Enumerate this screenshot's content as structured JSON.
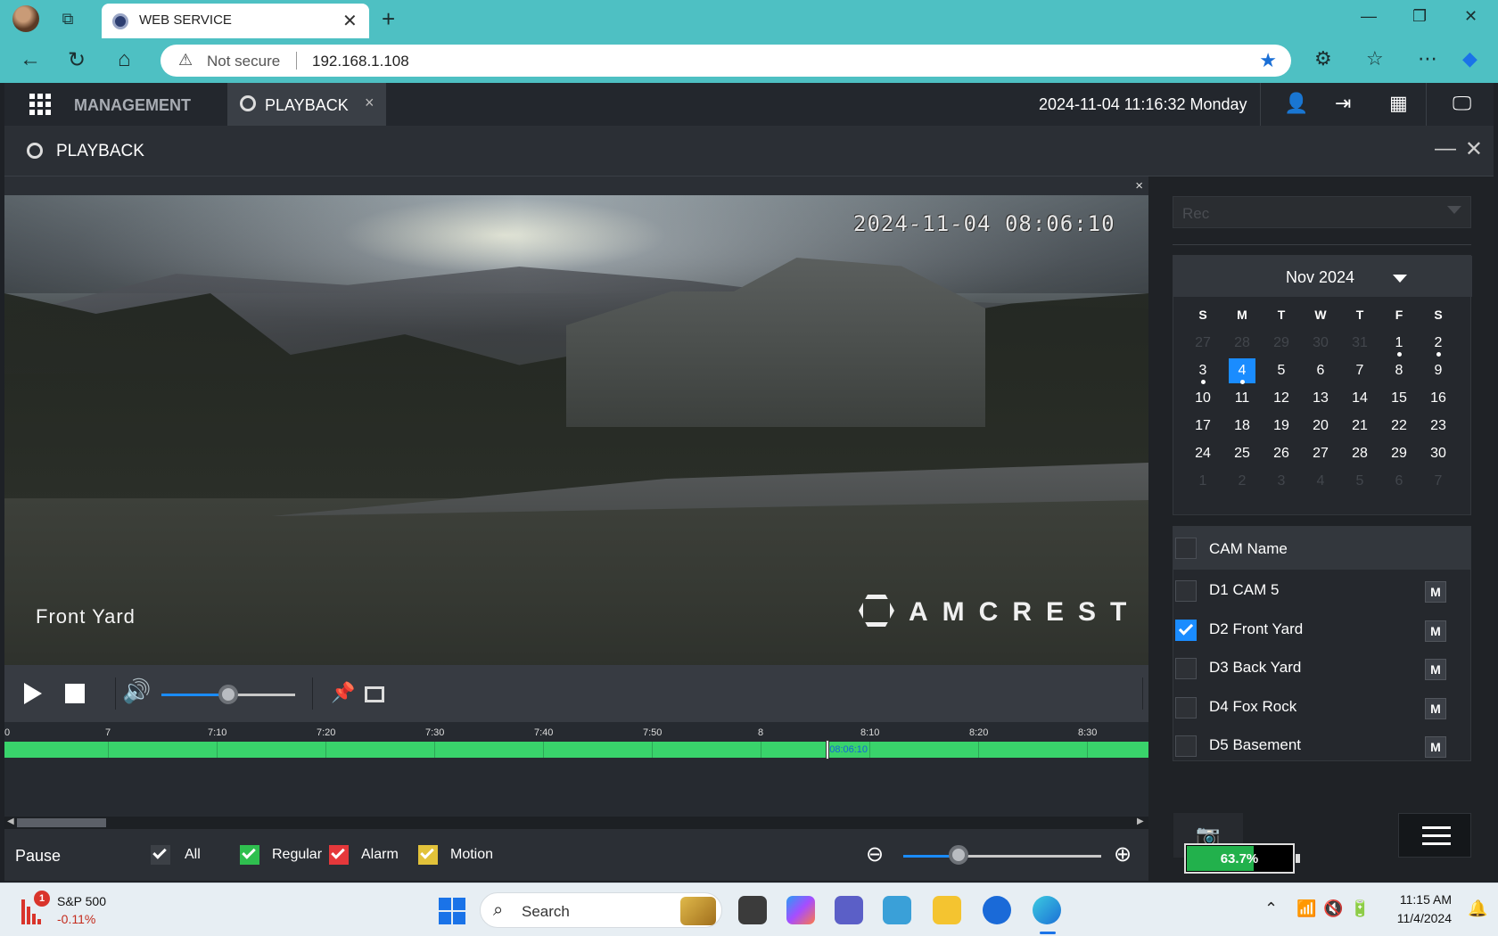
{
  "browser": {
    "tab_title": "WEB SERVICE",
    "tab_close": "✕",
    "new_tab": "+",
    "security_label": "Not secure",
    "url": "192.168.1.108",
    "window_controls": {
      "minimize": "—",
      "restore": "❐",
      "close": "✕"
    }
  },
  "app": {
    "menu_label": "MANAGEMENT",
    "active_tab": "PLAYBACK",
    "tab_close": "×",
    "datetime": "2024-11-04 11:16:32 Monday",
    "panel_title": "PLAYBACK",
    "panel_min": "—",
    "panel_close": "✕"
  },
  "video": {
    "close": "×",
    "osd_timestamp": "2024-11-04 08:06:10",
    "camera_name": "Front Yard",
    "brand": "AMCREST",
    "volume_level": 0.5
  },
  "timeline": {
    "ticks": [
      "0",
      "7",
      "7:10",
      "7:20",
      "7:30",
      "7:40",
      "7:50",
      "8",
      "8:10",
      "8:20",
      "8:30"
    ],
    "current_time": "08:06:10",
    "recording_type": "Regular",
    "scroll_left": "◀",
    "scroll_right": "▶"
  },
  "bottom": {
    "status": "Pause",
    "filters": [
      {
        "label": "All",
        "checked": true,
        "color": "#3c4046"
      },
      {
        "label": "Regular",
        "checked": true,
        "color": "#2fbf4f"
      },
      {
        "label": "Alarm",
        "checked": true,
        "color": "#e5383b"
      },
      {
        "label": "Motion",
        "checked": true,
        "color": "#e2c23a"
      }
    ],
    "zoom_out_icon": "⊖",
    "zoom_in_icon": "⊕",
    "zoom_level": 0.28
  },
  "sidebar": {
    "record_type_placeholder": "Rec",
    "calendar": {
      "month": "Nov 2024",
      "weekdays": [
        "S",
        "M",
        "T",
        "W",
        "T",
        "F",
        "S"
      ],
      "weeks": [
        [
          "27",
          "28",
          "29",
          "30",
          "31",
          "1",
          "2"
        ],
        [
          "3",
          "4",
          "5",
          "6",
          "7",
          "8",
          "9"
        ],
        [
          "10",
          "11",
          "12",
          "13",
          "14",
          "15",
          "16"
        ],
        [
          "17",
          "18",
          "19",
          "20",
          "21",
          "22",
          "23"
        ],
        [
          "24",
          "25",
          "26",
          "27",
          "28",
          "29",
          "30"
        ],
        [
          "1",
          "2",
          "3",
          "4",
          "5",
          "6",
          "7"
        ]
      ],
      "selected_day": "4",
      "days_with_records": [
        "1",
        "2",
        "3",
        "4"
      ]
    },
    "cam_header": "CAM Name",
    "cameras": [
      {
        "name": "D1 CAM 5",
        "checked": false,
        "btn": "M"
      },
      {
        "name": "D2 Front Yard",
        "checked": true,
        "btn": "M"
      },
      {
        "name": "D3 Back Yard",
        "checked": false,
        "btn": "M"
      },
      {
        "name": "D4 Fox Rock",
        "checked": false,
        "btn": "M"
      },
      {
        "name": "D5 Basement",
        "checked": false,
        "btn": "M"
      }
    ],
    "battery_percent": "63.7%",
    "battery_level": 0.637,
    "camera_icon": "📷"
  },
  "taskbar": {
    "widget_badge": "1",
    "widget_name": "S&P 500",
    "widget_change": "-0.11%",
    "search_label": "Search",
    "time": "11:15 AM",
    "date": "11/4/2024"
  },
  "colors": {
    "accent": "#1a8cff",
    "record_green": "#39d36b",
    "browser_chrome": "#4ec0c3"
  }
}
